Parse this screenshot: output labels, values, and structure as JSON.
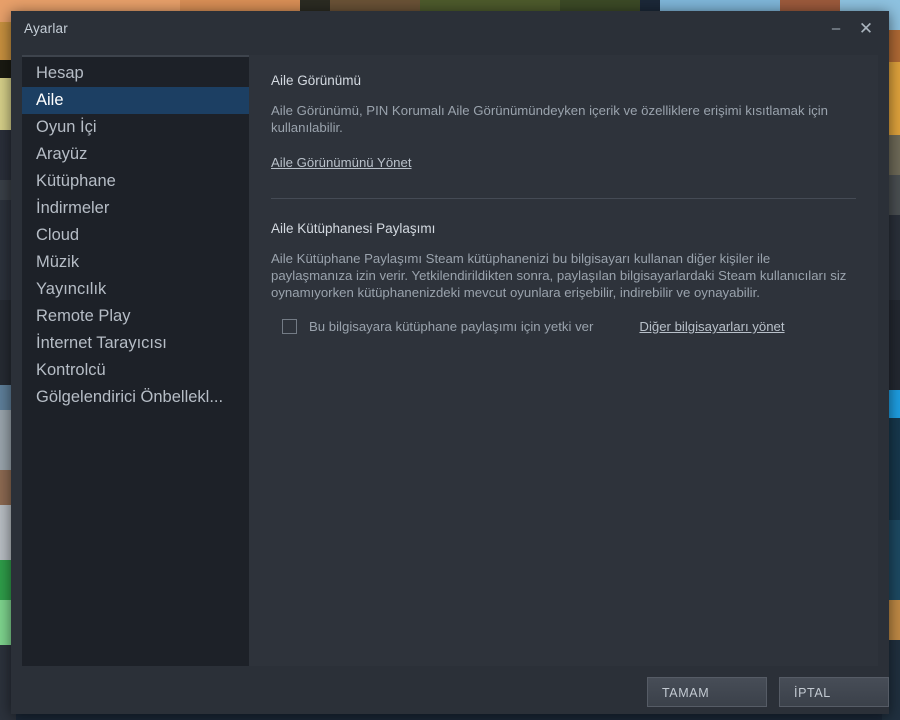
{
  "window": {
    "title": "Ayarlar",
    "minimize_label": "–",
    "close_label": "✕"
  },
  "sidebar": {
    "items": [
      {
        "label": "Hesap",
        "selected": false
      },
      {
        "label": "Aile",
        "selected": true
      },
      {
        "label": "Oyun İçi",
        "selected": false
      },
      {
        "label": "Arayüz",
        "selected": false
      },
      {
        "label": "Kütüphane",
        "selected": false
      },
      {
        "label": "İndirmeler",
        "selected": false
      },
      {
        "label": "Cloud",
        "selected": false
      },
      {
        "label": "Müzik",
        "selected": false
      },
      {
        "label": "Yayıncılık",
        "selected": false
      },
      {
        "label": "Remote Play",
        "selected": false
      },
      {
        "label": "İnternet Tarayıcısı",
        "selected": false
      },
      {
        "label": "Kontrolcü",
        "selected": false
      },
      {
        "label": "Gölgelendirici Önbellekl...",
        "selected": false
      }
    ]
  },
  "content": {
    "family_view": {
      "title": "Aile Görünümü",
      "description": "Aile Görünümü, PIN Korumalı Aile Görünümündeyken içerik ve özelliklere erişimi kısıtlamak için kullanılabilir.",
      "link": "Aile Görünümünü Yönet"
    },
    "library_sharing": {
      "title": "Aile Kütüphanesi Paylaşımı",
      "description": "Aile Kütüphane Paylaşımı Steam kütüphanenizi bu bilgisayarı kullanan diğer kişiler ile paylaşmanıza izin verir. Yetkilendirildikten sonra, paylaşılan bilgisayarlardaki Steam kullanıcıları siz oynamıyorken kütüphanenizdeki mevcut oyunlara erişebilir, indirebilir ve oynayabilir.",
      "checkbox_label": "Bu bilgisayara kütüphane paylaşımı için yetki ver",
      "checkbox_checked": false,
      "manage_link": "Diğer bilgisayarları yönet"
    }
  },
  "footer": {
    "ok_label": "TAMAM",
    "cancel_label": "İPTAL"
  },
  "colors": {
    "dialog_bg": "#2b3038",
    "sidebar_bg": "#1d2128",
    "content_bg": "#2e333b",
    "selection": "#1c3f63",
    "text_primary": "#d4dae1",
    "text_secondary": "#9aa3ad"
  }
}
